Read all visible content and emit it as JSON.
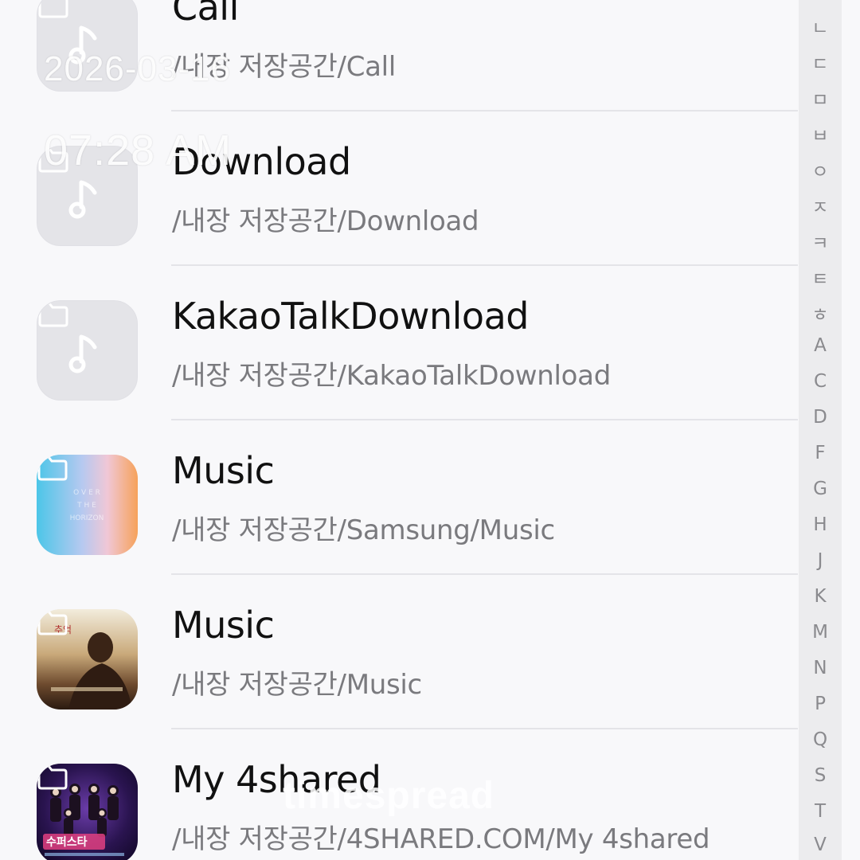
{
  "folders": [
    {
      "name": "Call",
      "path": "/내장 저장공간/Call",
      "thumb": "placeholder"
    },
    {
      "name": "Download",
      "path": "/내장 저장공간/Download",
      "thumb": "placeholder"
    },
    {
      "name": "KakaoTalkDownload",
      "path": "/내장 저장공간/KakaoTalkDownload",
      "thumb": "placeholder"
    },
    {
      "name": "Music",
      "path": "/내장 저장공간/Samsung/Music",
      "thumb": "album-art-gradient"
    },
    {
      "name": "Music",
      "path": "/내장 저장공간/Music",
      "thumb": "album-art-photo"
    },
    {
      "name": "My 4shared",
      "path": "/내장 저장공간/4SHARED.COM/My 4shared",
      "thumb": "album-art-group"
    }
  ],
  "index_bar": {
    "letters": [
      "ㄴ",
      "ㄷ",
      "ㅁ",
      "ㅂ",
      "ㅇ",
      "ㅈ",
      "ㅋ",
      "ㅌ",
      "ㅎ",
      "A",
      "C",
      "D",
      "F",
      "G",
      "H",
      "J",
      "K",
      "M",
      "N",
      "P",
      "Q",
      "S",
      "T",
      "V"
    ]
  },
  "overlay": {
    "date": "2026-03-16",
    "time": "07:28 AM",
    "watermark": "timespread"
  },
  "colors": {
    "background": "#f8f8fa",
    "placeholder_tile": "#e4e4e8",
    "title_text": "#111111",
    "path_text": "#7a7a7e",
    "index_bar": "#ececee"
  }
}
